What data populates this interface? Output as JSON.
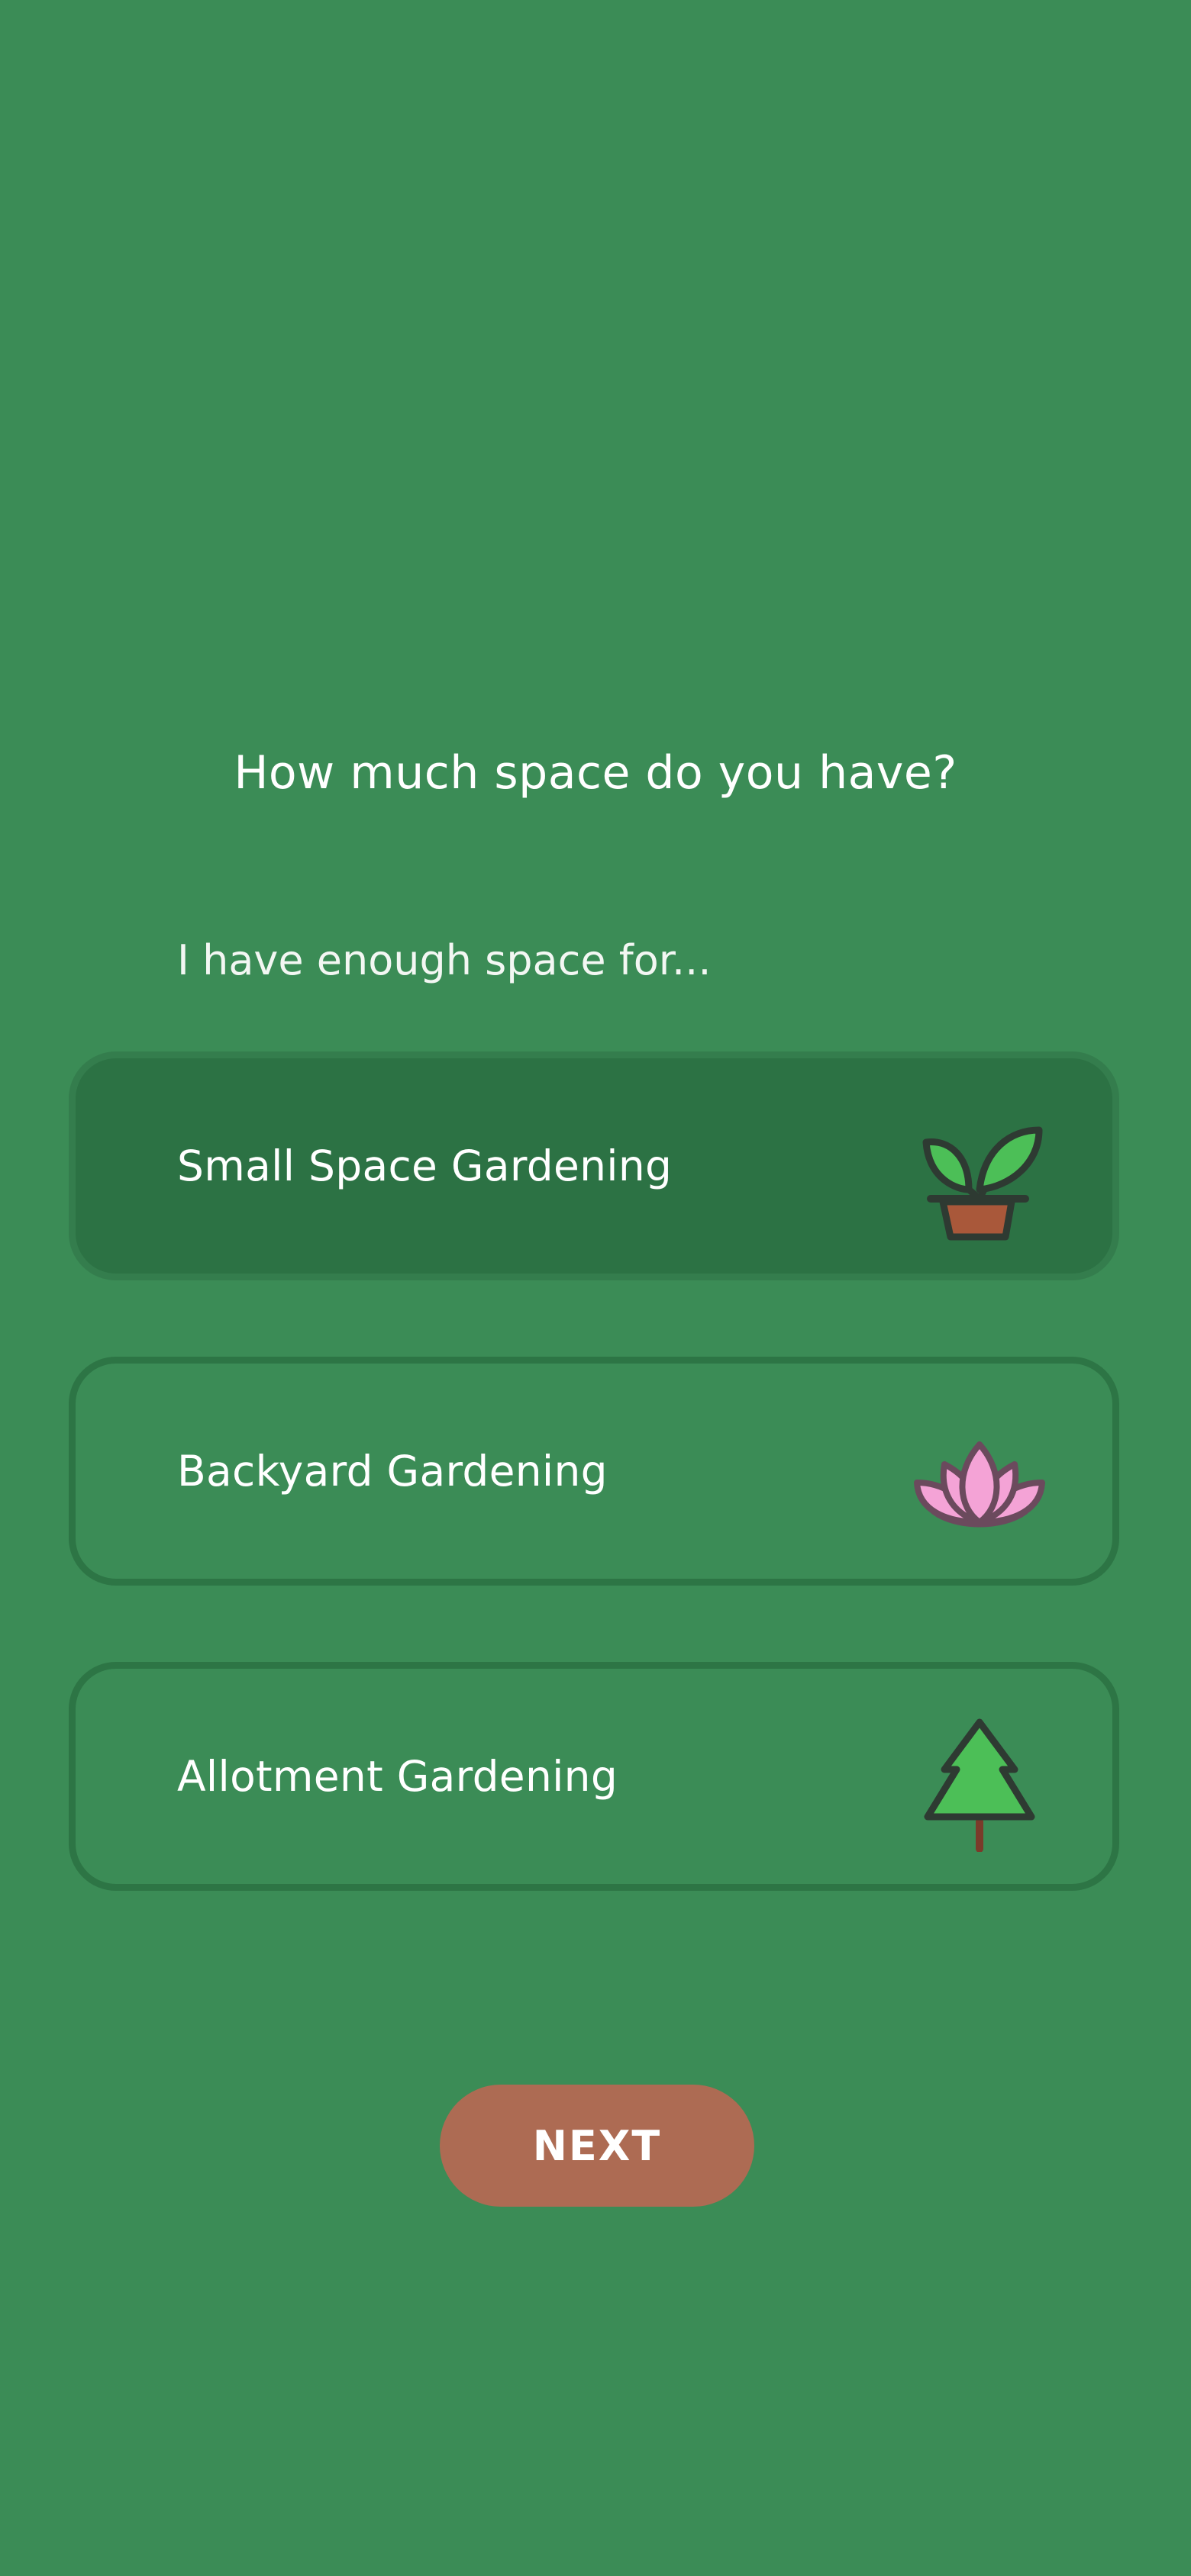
{
  "question": "How much space do you have?",
  "subtitle": "I have enough space for...",
  "options": [
    {
      "label": "Small Space Gardening",
      "icon": "potted-seedling-icon",
      "selected": true
    },
    {
      "label": "Backyard Gardening",
      "icon": "lotus-flower-icon",
      "selected": false
    },
    {
      "label": "Allotment Gardening",
      "icon": "pine-tree-icon",
      "selected": false
    }
  ],
  "next_button": {
    "label": "NEXT"
  },
  "colors": {
    "background": "#3b8c56",
    "selected_option": "#2c7244",
    "option_border": "#2d7545",
    "button": "#ad6b53",
    "text": "#ffffff"
  }
}
